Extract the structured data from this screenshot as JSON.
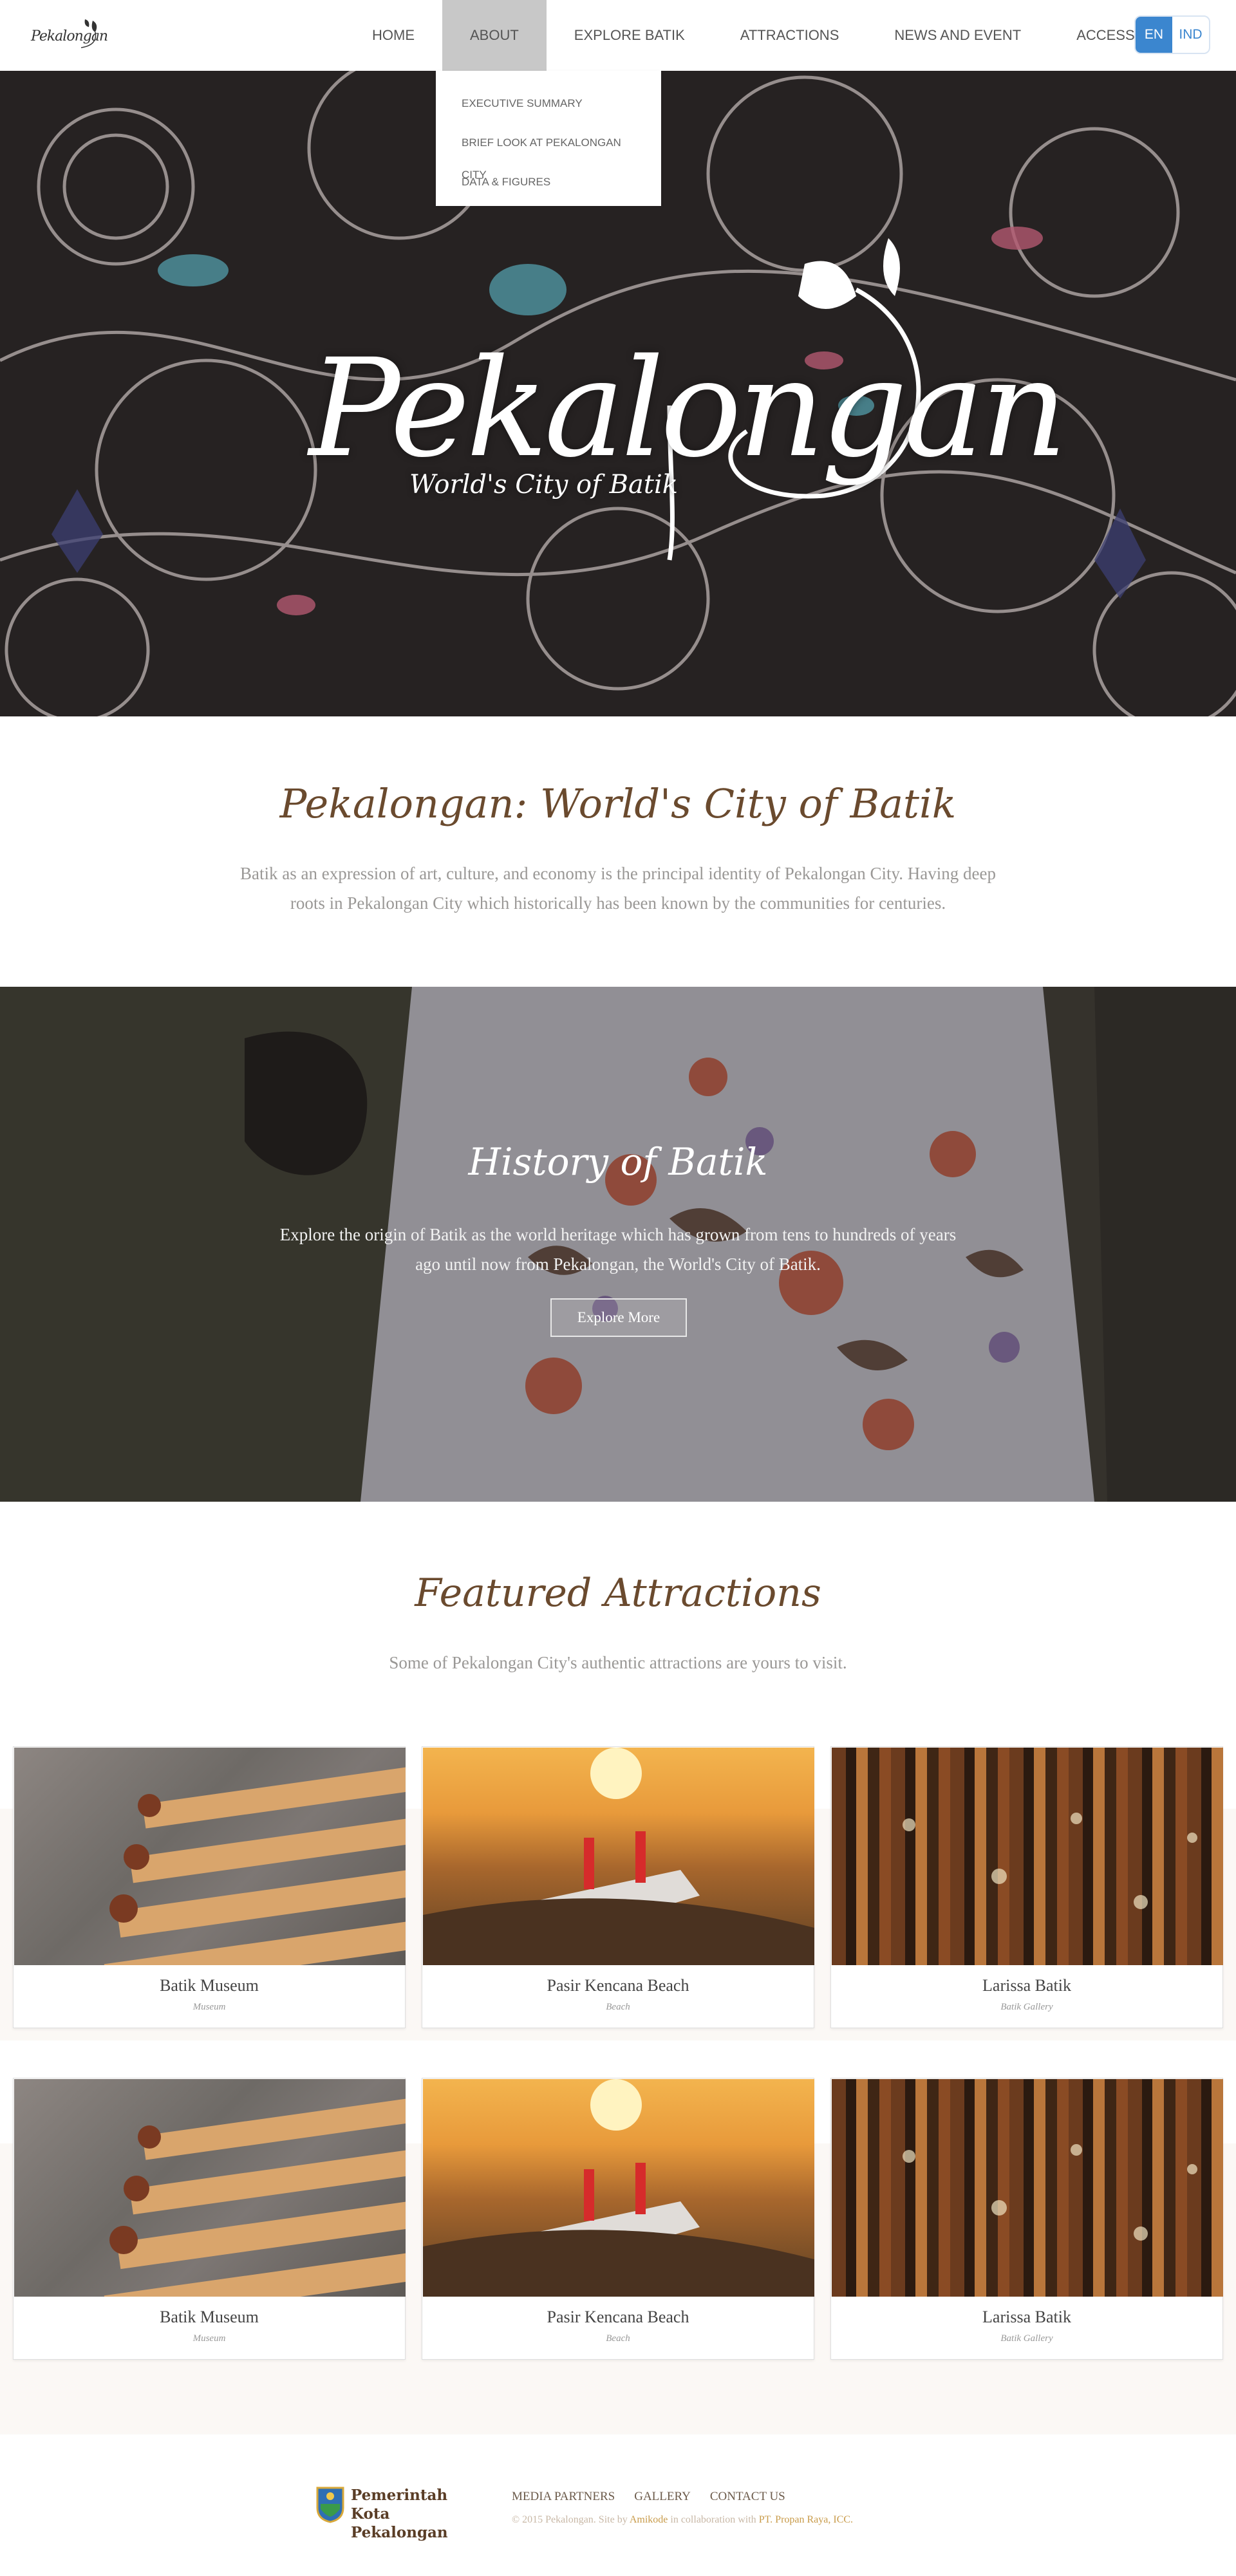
{
  "nav": {
    "logo_text": "Pekalongan",
    "items": [
      "HOME",
      "ABOUT",
      "EXPLORE BATIK",
      "ATTRACTIONS",
      "NEWS AND EVENT",
      "ACCESS"
    ],
    "active": "ABOUT",
    "lang_en": "EN",
    "lang_ind": "IND"
  },
  "dropdown": [
    "EXECUTIVE SUMMARY",
    "BRIEF LOOK AT PEKALONGAN CITY",
    "DATA & FIGURES"
  ],
  "hero": {
    "title": "Pekalongan",
    "subtitle": "World's City of Batik"
  },
  "intro": {
    "title": "Pekalongan: World's City of Batik",
    "text": "Batik as an expression of art, culture, and economy is the principal identity of Pekalongan City. Having deep roots in Pekalongan City which historically has been known by the communities for centuries."
  },
  "history": {
    "title": "History of Batik",
    "text": "Explore the origin of Batik as the world heritage which has grown from tens to hundreds of years ago until now from Pekalongan, the World's City of Batik.",
    "button": "Explore More"
  },
  "featured": {
    "title": "Featured Attractions",
    "subtitle": "Some of Pekalongan City's authentic attractions are yours to visit.",
    "cards": [
      {
        "name": "Batik Museum",
        "category": "Museum"
      },
      {
        "name": "Pasir Kencana Beach",
        "category": "Beach"
      },
      {
        "name": "Larissa Batik",
        "category": "Batik Gallery"
      },
      {
        "name": "Batik Museum",
        "category": "Museum"
      },
      {
        "name": "Pasir Kencana Beach",
        "category": "Beach"
      },
      {
        "name": "Larissa Batik",
        "category": "Batik Gallery"
      }
    ]
  },
  "footer": {
    "logo_line1": "Pemerintah",
    "logo_line2": "Kota Pekalongan",
    "links": [
      "MEDIA PARTNERS",
      "GALLERY",
      "CONTACT US"
    ],
    "copy_prefix": "© 2015 Pekalongan. Site by",
    "copy_site": "Amikode",
    "copy_mid": "in collaboration with",
    "copy_partner": "PT. Propan Raya, ICC."
  },
  "colors": {
    "accent_blue": "#3b86cf",
    "heading_brown": "#6a4a2e",
    "nav_active_bg": "#c8c8c8"
  }
}
